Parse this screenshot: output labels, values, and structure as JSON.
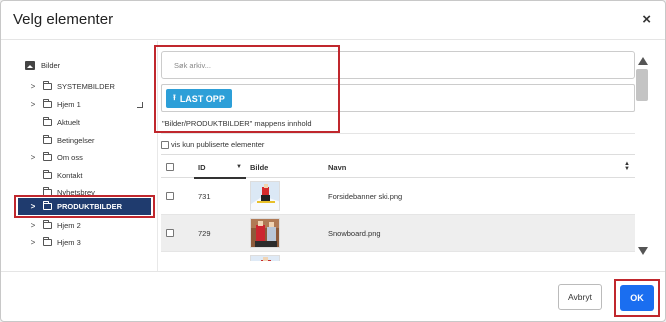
{
  "dialog": {
    "title": "Velg elementer",
    "close": "×"
  },
  "tree": {
    "root": "Bilder",
    "items": [
      {
        "label": "SYSTEMBILDER",
        "expandable": true
      },
      {
        "label": "Hjem 1",
        "expandable": true
      },
      {
        "label": "Aktuelt",
        "expandable": false
      },
      {
        "label": "Betingelser",
        "expandable": false
      },
      {
        "label": "Om oss",
        "expandable": true
      },
      {
        "label": "Kontakt",
        "expandable": false
      },
      {
        "label": "Nyhetsbrev",
        "expandable": false
      },
      {
        "label": "PRODUKTBILDER",
        "expandable": true,
        "selected": true
      },
      {
        "label": "Hjem 2",
        "expandable": true
      },
      {
        "label": "Hjem 3",
        "expandable": true
      }
    ]
  },
  "search": {
    "placeholder": "Søk arkiv..."
  },
  "upload": {
    "label": "LAST OPP"
  },
  "info": "\"Bilder/PRODUKTBILDER\" mappens innhold",
  "filter": {
    "label": "vis kun publiserte elementer"
  },
  "table": {
    "headers": {
      "id": "ID",
      "image": "Bilde",
      "name": "Navn"
    },
    "rows": [
      {
        "id": "731",
        "name": "Forsidebanner ski.png"
      },
      {
        "id": "729",
        "name": "Snowboard.png"
      },
      {
        "id": "",
        "name": ""
      }
    ]
  },
  "footer": {
    "cancel": "Avbryt",
    "ok": "OK"
  },
  "colors": {
    "accent": "#1a6ef0",
    "upload": "#2d9fd8",
    "selected": "#1f3b6e",
    "highlight": "#c0272d"
  }
}
